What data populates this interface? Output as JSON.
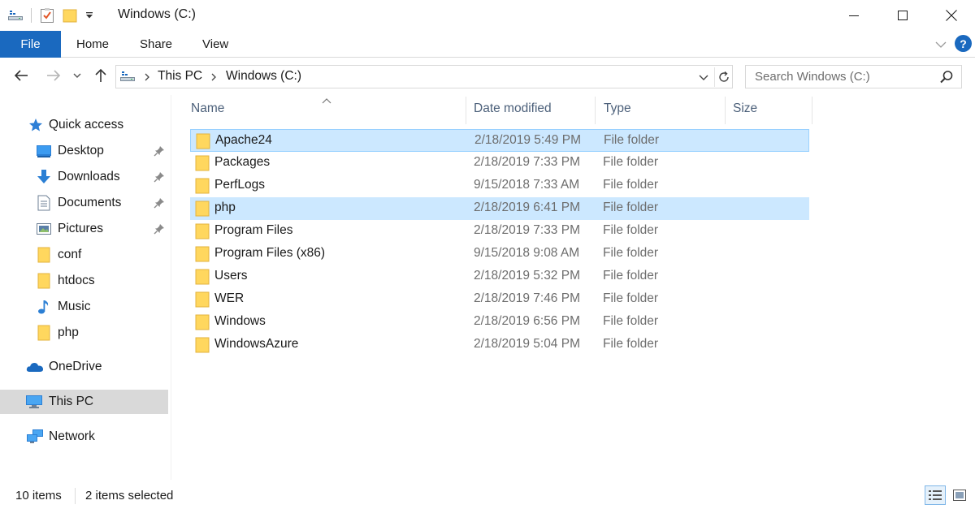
{
  "window": {
    "title": "Windows (C:)",
    "minimize_label": "Minimize",
    "maximize_label": "Maximize",
    "close_label": "Close"
  },
  "ribbon": {
    "tabs": [
      {
        "label": "File"
      },
      {
        "label": "Home"
      },
      {
        "label": "Share"
      },
      {
        "label": "View"
      }
    ],
    "help": "?"
  },
  "address": {
    "crumbs": [
      "This PC",
      "Windows (C:)"
    ]
  },
  "search": {
    "placeholder": "Search Windows (C:)"
  },
  "navpane": {
    "items": [
      {
        "label": "Quick access",
        "icon": "star-icon"
      },
      {
        "label": "Desktop",
        "icon": "desktop-icon",
        "pinned": true
      },
      {
        "label": "Downloads",
        "icon": "download-icon",
        "pinned": true
      },
      {
        "label": "Documents",
        "icon": "documents-icon",
        "pinned": true
      },
      {
        "label": "Pictures",
        "icon": "pictures-icon",
        "pinned": true
      },
      {
        "label": "conf",
        "icon": "folder-icon"
      },
      {
        "label": "htdocs",
        "icon": "folder-icon"
      },
      {
        "label": "Music",
        "icon": "music-icon"
      },
      {
        "label": "php",
        "icon": "folder-icon"
      },
      {
        "label": "OneDrive",
        "icon": "onedrive-icon"
      },
      {
        "label": "This PC",
        "icon": "computer-icon",
        "selected": true
      },
      {
        "label": "Network",
        "icon": "network-icon"
      }
    ]
  },
  "columns": {
    "name": "Name",
    "date": "Date modified",
    "type": "Type",
    "size": "Size"
  },
  "files": [
    {
      "name": "Apache24",
      "date": "2/18/2019 5:49 PM",
      "type": "File folder",
      "selected": true
    },
    {
      "name": "Packages",
      "date": "2/18/2019 7:33 PM",
      "type": "File folder"
    },
    {
      "name": "PerfLogs",
      "date": "9/15/2018 7:33 AM",
      "type": "File folder"
    },
    {
      "name": "php",
      "date": "2/18/2019 6:41 PM",
      "type": "File folder",
      "selected": true
    },
    {
      "name": "Program Files",
      "date": "2/18/2019 7:33 PM",
      "type": "File folder"
    },
    {
      "name": "Program Files (x86)",
      "date": "9/15/2018 9:08 AM",
      "type": "File folder"
    },
    {
      "name": "Users",
      "date": "2/18/2019 5:32 PM",
      "type": "File folder"
    },
    {
      "name": "WER",
      "date": "2/18/2019 7:46 PM",
      "type": "File folder"
    },
    {
      "name": "Windows",
      "date": "2/18/2019 6:56 PM",
      "type": "File folder"
    },
    {
      "name": "WindowsAzure",
      "date": "2/18/2019 5:04 PM",
      "type": "File folder"
    }
  ],
  "status": {
    "item_count": "10 items",
    "selection": "2 items selected"
  },
  "colors": {
    "accent": "#1a69bf",
    "selection": "#cce8ff",
    "folder": "#ffd75e"
  }
}
